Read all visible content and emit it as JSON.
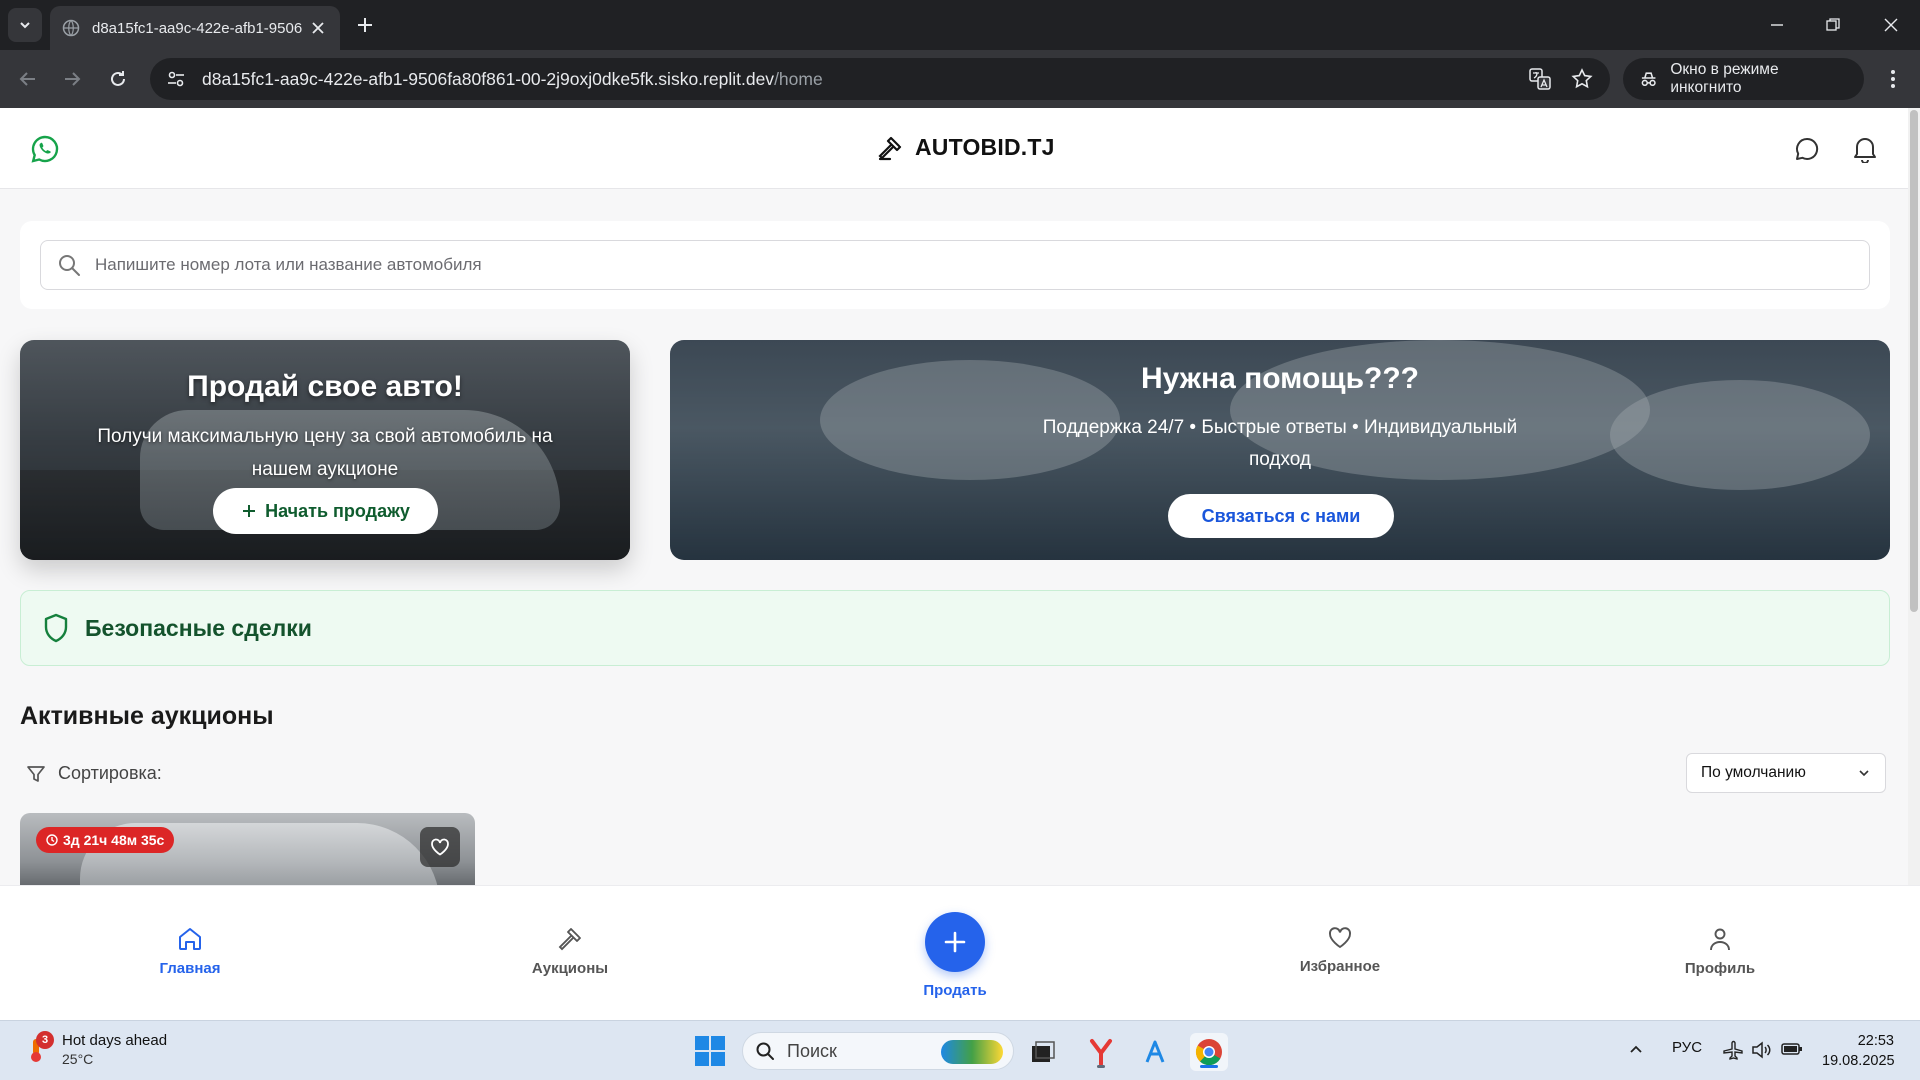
{
  "browser": {
    "tab_title": "d8a15fc1-aa9c-422e-afb1-9506",
    "url_host": "d8a15fc1-aa9c-422e-afb1-9506fa80f861-00-2j9oxj0dke5fk.sisko.replit.dev",
    "url_path": "/home",
    "incognito_label": "Окно в режиме инкогнито"
  },
  "header": {
    "brand": "AUTOBID.TJ"
  },
  "search": {
    "placeholder": "Напишите номер лота или название автомобиля"
  },
  "sell_banner": {
    "title": "Продай свое авто!",
    "subtitle": "Получи максимальную цену за свой автомобиль на нашем аукционе",
    "button": "Начать продажу"
  },
  "help_banner": {
    "title": "Нужна помощь???",
    "subtitle": "Поддержка 24/7 • Быстрые ответы • Индивидуальный подход",
    "button": "Связаться с нами"
  },
  "secure": {
    "label": "Безопасные сделки"
  },
  "auctions": {
    "title": "Активные аукционы",
    "sort_label": "Сортировка:",
    "sort_value": "По умолчанию",
    "lots": [
      {
        "timer": "3д 21ч 48м 35с"
      }
    ]
  },
  "bottom_nav": {
    "items": [
      {
        "label": "Главная",
        "icon": "home-icon",
        "active": true
      },
      {
        "label": "Аукционы",
        "icon": "gavel-icon",
        "active": false
      },
      {
        "label": "Продать",
        "icon": "plus-icon",
        "active": false
      },
      {
        "label": "Избранное",
        "icon": "heart-icon",
        "active": false
      },
      {
        "label": "Профиль",
        "icon": "user-icon",
        "active": false
      }
    ]
  },
  "taskbar": {
    "weather_title": "Hot days ahead",
    "weather_temp": "25°C",
    "weather_badge": "3",
    "search_label": "Поиск",
    "language": "РУС",
    "time": "22:53",
    "date": "19.08.2025"
  },
  "colors": {
    "accent": "#2563eb",
    "brand_green": "#14532d",
    "timer_red": "#dc2626",
    "secure_bg": "#eefaf2"
  }
}
